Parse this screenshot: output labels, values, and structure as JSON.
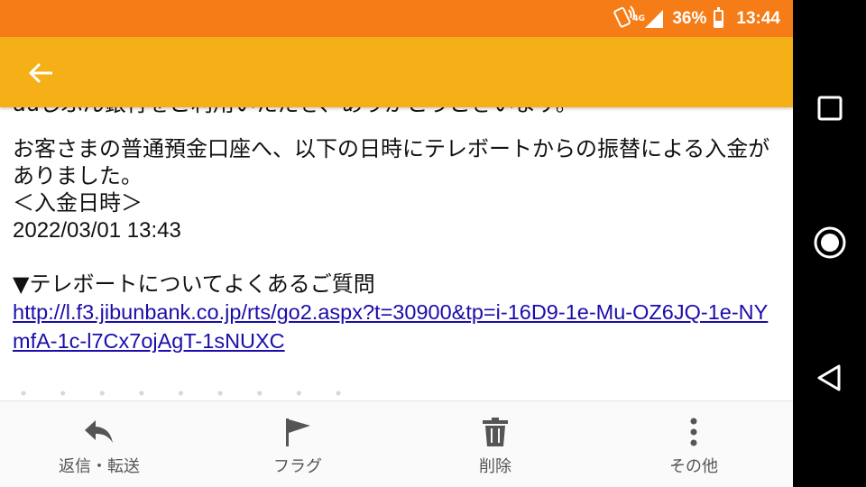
{
  "status_bar": {
    "network": "4G",
    "battery": "36%",
    "battery_level": 0.36,
    "time": "13:44",
    "icons": [
      "vibrate-icon",
      "signal-icon",
      "battery-icon"
    ]
  },
  "app_bar": {
    "back_icon": "arrow-back-icon"
  },
  "message": {
    "cut_top_line": "auじぶん銀行をご利用いただき、ありがとうございます。",
    "paragraph_1": "お客さまの普通預金口座へ、以下の日時にテレボートからの振替による入金がありました。",
    "deposit_label": "＜入金日時＞",
    "deposit_datetime": "2022/03/01 13:43",
    "faq_heading": "▼テレボートについてよくあるご質問",
    "faq_link": "http://l.f3.jibunbank.co.jp/rts/go2.aspx?t=30900&tp=i-16D9-1e-Mu-OZ6JQ-1e-NYmfA-1c-l7Cx7ojAgT-1sNUXC",
    "cut_bottom_line": "・ ・ ・ ・ ・ ・ ・ ・ ・"
  },
  "bottom_bar": {
    "reply": {
      "label": "返信・転送",
      "icon": "reply-icon"
    },
    "flag": {
      "label": "フラグ",
      "icon": "flag-icon"
    },
    "delete": {
      "label": "削除",
      "icon": "trash-icon"
    },
    "more": {
      "label": "その他",
      "icon": "more-vertical-icon"
    }
  },
  "nav_bar": {
    "recents_icon": "recents-square-icon",
    "home_icon": "home-circle-icon",
    "back_icon": "back-triangle-icon"
  },
  "colors": {
    "status_bar": "#f57c17",
    "app_bar": "#f5af17",
    "link": "#1a0dab",
    "nav_bar": "#000000"
  }
}
